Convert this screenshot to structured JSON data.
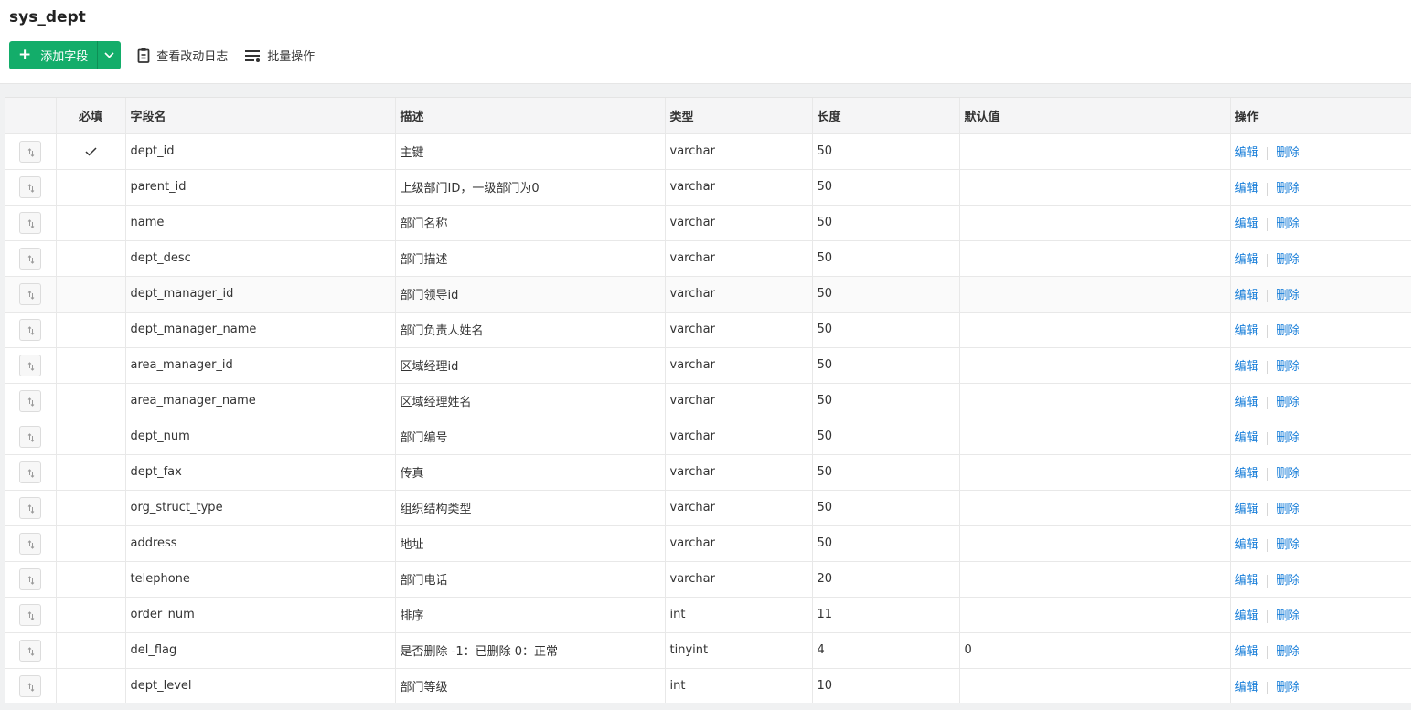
{
  "title": "sys_dept",
  "toolbar": {
    "add_field_label": "添加字段",
    "change_log_label": "查看改动日志",
    "batch_ops_label": "批量操作"
  },
  "columns": {
    "required": "必填",
    "field_name": "字段名",
    "description": "描述",
    "type": "类型",
    "length": "长度",
    "default": "默认值",
    "actions": "操作"
  },
  "actions": {
    "edit": "编辑",
    "delete": "删除"
  },
  "rows": [
    {
      "required": true,
      "name": "dept_id",
      "desc": "主键",
      "type": "varchar",
      "length": "50",
      "default": ""
    },
    {
      "required": false,
      "name": "parent_id",
      "desc": "上级部门ID，一级部门为0",
      "type": "varchar",
      "length": "50",
      "default": ""
    },
    {
      "required": false,
      "name": "name",
      "desc": "部门名称",
      "type": "varchar",
      "length": "50",
      "default": ""
    },
    {
      "required": false,
      "name": "dept_desc",
      "desc": "部门描述",
      "type": "varchar",
      "length": "50",
      "default": ""
    },
    {
      "required": false,
      "name": "dept_manager_id",
      "desc": "部门领导id",
      "type": "varchar",
      "length": "50",
      "default": ""
    },
    {
      "required": false,
      "name": "dept_manager_name",
      "desc": "部门负责人姓名",
      "type": "varchar",
      "length": "50",
      "default": ""
    },
    {
      "required": false,
      "name": "area_manager_id",
      "desc": "区域经理id",
      "type": "varchar",
      "length": "50",
      "default": ""
    },
    {
      "required": false,
      "name": "area_manager_name",
      "desc": "区域经理姓名",
      "type": "varchar",
      "length": "50",
      "default": ""
    },
    {
      "required": false,
      "name": "dept_num",
      "desc": "部门编号",
      "type": "varchar",
      "length": "50",
      "default": ""
    },
    {
      "required": false,
      "name": "dept_fax",
      "desc": "传真",
      "type": "varchar",
      "length": "50",
      "default": ""
    },
    {
      "required": false,
      "name": "org_struct_type",
      "desc": "组织结构类型",
      "type": "varchar",
      "length": "50",
      "default": ""
    },
    {
      "required": false,
      "name": "address",
      "desc": "地址",
      "type": "varchar",
      "length": "50",
      "default": ""
    },
    {
      "required": false,
      "name": "telephone",
      "desc": "部门电话",
      "type": "varchar",
      "length": "20",
      "default": ""
    },
    {
      "required": false,
      "name": "order_num",
      "desc": "排序",
      "type": "int",
      "length": "11",
      "default": ""
    },
    {
      "required": false,
      "name": "del_flag",
      "desc": "是否删除 -1：已删除 0：正常",
      "type": "tinyint",
      "length": "4",
      "default": "0"
    },
    {
      "required": false,
      "name": "dept_level",
      "desc": "部门等级",
      "type": "int",
      "length": "10",
      "default": ""
    }
  ],
  "colors": {
    "primary": "#13ad6a",
    "link": "#1a7fd9"
  }
}
